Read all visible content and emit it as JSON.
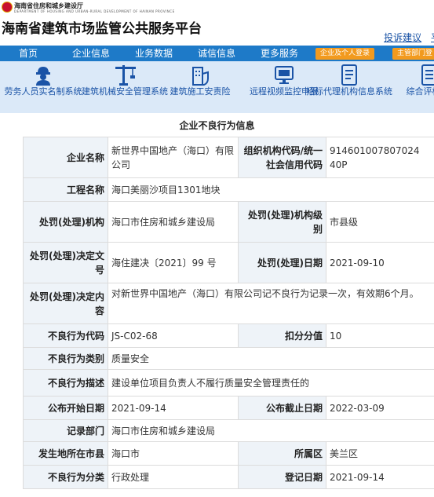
{
  "header": {
    "department": "海南省住房和城乡建设厅",
    "department_en": "DEPARTMENT OF HOUSING AND URBAN-RURAL DEVELOPMENT OF HAINAN PROVINCE",
    "site_title": "海南省建筑市场监管公共服务平台",
    "links": [
      "投诉建议",
      "平"
    ]
  },
  "nav": {
    "items": [
      "首页",
      "企业信息",
      "业务数据",
      "诚信信息",
      "更多服务"
    ],
    "buttons": [
      "企业及个人登录",
      "主管部门登"
    ]
  },
  "quick_links": [
    {
      "label": "劳务人员实名制系统",
      "icon": "worker-icon"
    },
    {
      "label": "建筑机械安全管理系统",
      "icon": "tower-crane-icon"
    },
    {
      "label": "建筑施工安责险",
      "icon": "building-shield-icon"
    },
    {
      "label": "远程视频监控申报",
      "icon": "monitor-icon"
    },
    {
      "label": "招标代理机构信息系统",
      "icon": "document-icon"
    },
    {
      "label": "综合评标专",
      "icon": "document-list-icon"
    }
  ],
  "record": {
    "title": "企业不良行为信息",
    "fields": {
      "enterprise_name_label": "企业名称",
      "enterprise_name": "新世界中国地产（海口）有限公司",
      "org_code_label": "组织机构代码/统一社会信用代码",
      "org_code": "914601007807024 40P",
      "project_label": "工程名称",
      "project": "海口美丽沙项目1301地块",
      "penalty_org_label": "处罚(处理)机构",
      "penalty_org": "海口市住房和城乡建设局",
      "penalty_level_label": "处罚(处理)机构级别",
      "penalty_level": "市县级",
      "decision_no_label": "处罚(处理)决定文号",
      "decision_no": "海住建决〔2021〕99 号",
      "penalty_date_label": "处罚(处理)日期",
      "penalty_date": "2021-09-10",
      "decision_content_label": "处罚(处理)决定内容",
      "decision_content": "对新世界中国地产（海口）有限公司记不良行为记录一次，有效期6个月。",
      "code_label": "不良行为代码",
      "code": "JS-C02-68",
      "points_label": "扣分分值",
      "points": "10",
      "category_label": "不良行为类别",
      "category": "质量安全",
      "description_label": "不良行为描述",
      "description": "建设单位项目负责人不履行质量安全管理责任的",
      "publish_start_label": "公布开始日期",
      "publish_start": "2021-09-14",
      "publish_end_label": "公布截止日期",
      "publish_end": "2022-03-09",
      "record_dept_label": "记录部门",
      "record_dept": "海口市住房和城乡建设局",
      "city_label": "发生地所在市县",
      "city": "海口市",
      "district_label": "所属区",
      "district": "美兰区",
      "classification_label": "不良行为分类",
      "classification": "行政处理",
      "register_date_label": "登记日期",
      "register_date": "2021-09-14"
    }
  },
  "colors": {
    "nav_blue": "#1e7ac8",
    "orange": "#f29a1e",
    "link_blue": "#1a53a6",
    "icon_strip": "#dbe9f8",
    "label_bg": "#eef3f8"
  }
}
